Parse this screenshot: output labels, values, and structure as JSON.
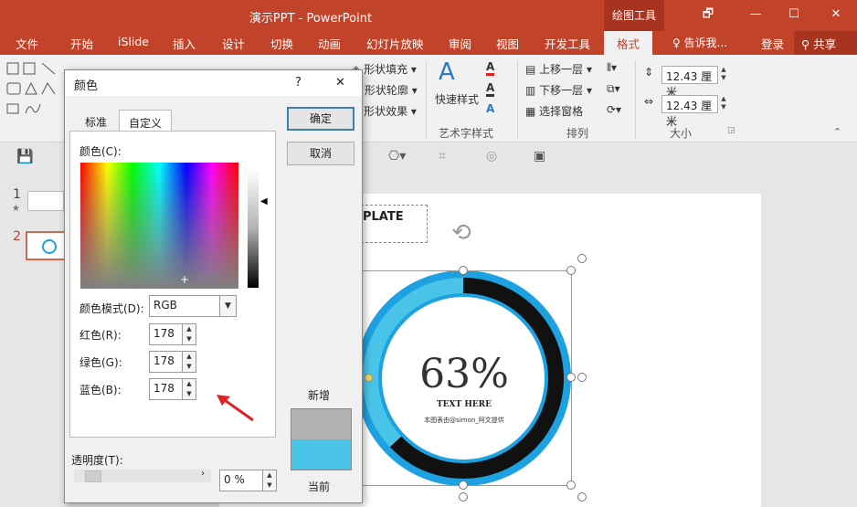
{
  "window": {
    "title": "演示PPT - PowerPoint",
    "context_tab": "绘图工具",
    "controls": {
      "restore": "🗗",
      "minimize": "—",
      "maximize": "☐",
      "close": "✕"
    }
  },
  "tabs": [
    "文件",
    "开始",
    "iSlide",
    "插入",
    "设计",
    "切换",
    "动画",
    "幻灯片放映",
    "审阅",
    "视图",
    "开发工具",
    "格式"
  ],
  "active_tab": "格式",
  "tell_me": "告诉我...",
  "login": "登录",
  "share": "共享",
  "ribbon": {
    "shape_fill": "形状填充",
    "shape_outline": "形状轮廓",
    "shape_effect": "形状效果",
    "quick_styles": "快速样式",
    "wordart_group": "艺术字样式",
    "bring_forward": "上移一层",
    "send_backward": "下移一层",
    "selection_pane": "选择窗格",
    "arrange_group": "排列",
    "height_value": "12.43 厘米",
    "width_value": "12.43 厘米",
    "size_group": "大小"
  },
  "slides": {
    "numbers": [
      "1",
      "2"
    ],
    "star": "★"
  },
  "slide": {
    "template_text": "PLATE",
    "percent": "63%",
    "text_here": "TEXT HERE",
    "credit": "本图表由@simon_阿文提供",
    "progress": 0.63,
    "colors": {
      "ring_black": "#111111",
      "ring_blue": "#1da1e0",
      "ring_light": "#49c4e8"
    }
  },
  "dialog": {
    "title": "颜色",
    "help": "?",
    "close": "✕",
    "tab_standard": "标准",
    "tab_custom": "自定义",
    "color_label": "颜色(C):",
    "mode_label": "颜色模式(D):",
    "mode_value": "RGB",
    "red_label": "红色(R):",
    "green_label": "绿色(G):",
    "blue_label": "蓝色(B):",
    "red_value": "178",
    "green_value": "178",
    "blue_value": "178",
    "ok": "确定",
    "cancel": "取消",
    "new_label": "新增",
    "current_label": "当前",
    "transparency_label": "透明度(T):",
    "transparency_value": "0 %",
    "new_color": "#b2b2b2",
    "current_color": "#49c4e8"
  }
}
